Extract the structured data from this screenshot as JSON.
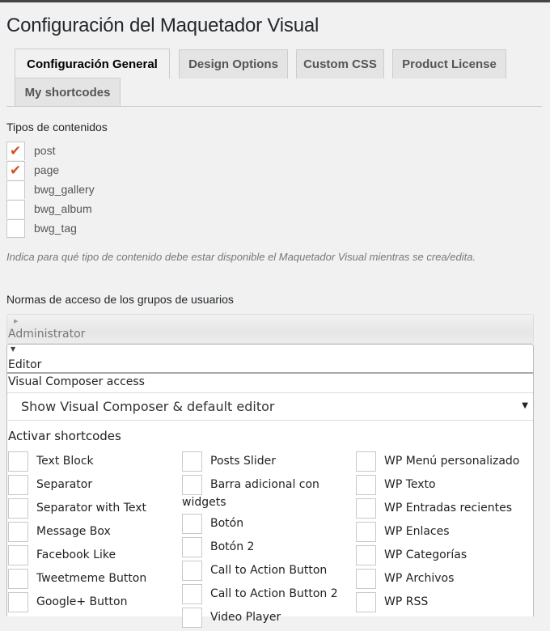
{
  "page": {
    "title": "Configuración del Maquetador Visual"
  },
  "tabs": [
    {
      "label": "Configuración General",
      "active": true
    },
    {
      "label": "Design Options",
      "active": false
    },
    {
      "label": "Custom CSS",
      "active": false
    },
    {
      "label": "Product License",
      "active": false
    },
    {
      "label": "My shortcodes",
      "active": false
    }
  ],
  "content_types": {
    "label": "Tipos de contenidos",
    "items": [
      {
        "label": "post",
        "checked": true
      },
      {
        "label": "page",
        "checked": true
      },
      {
        "label": "bwg_gallery",
        "checked": false
      },
      {
        "label": "bwg_album",
        "checked": false
      },
      {
        "label": "bwg_tag",
        "checked": false
      }
    ],
    "hint": "Indica para qué tipo de contenido debe estar disponible el Maquetador Visual mientras se crea/edita."
  },
  "access": {
    "label": "Normas de acceso de los grupos de usuarios",
    "roles": [
      {
        "name": "Administrator",
        "expanded": false,
        "arrow_icon": "triangle-right"
      },
      {
        "name": "Editor",
        "expanded": true,
        "arrow_icon": "triangle-down"
      }
    ],
    "editor": {
      "vc_access_label": "Visual Composer access",
      "vc_access_value": "Show Visual Composer & default editor",
      "activar_label": "Activar shortcodes",
      "shortcodes": {
        "col1": [
          "Text Block",
          "Separator",
          "Separator with Text",
          "Message Box",
          "Facebook Like",
          "Tweetmeme Button",
          "Google+ Button"
        ],
        "col2": [
          "Posts Slider",
          "Barra adicional con widgets",
          "Botón",
          "Botón 2",
          "Call to Action Button",
          "Call to Action Button 2",
          "Video Player"
        ],
        "col3": [
          "WP Menú personalizado",
          "WP Texto",
          "WP Entradas recientes",
          "WP Enlaces",
          "WP Categorías",
          "WP Archivos",
          "WP RSS"
        ]
      }
    }
  },
  "colors": {
    "check": "#d54e21",
    "background": "#f1f1f1"
  }
}
